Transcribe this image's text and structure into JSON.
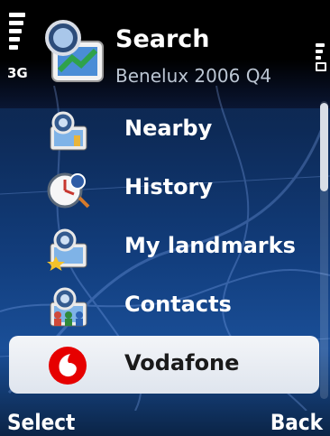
{
  "status": {
    "network": "3G"
  },
  "header": {
    "title": "Search",
    "subtitle": "Benelux 2006 Q4"
  },
  "menu": {
    "items": [
      {
        "label": "Nearby",
        "icon": "map-pin-nearby-icon"
      },
      {
        "label": "History",
        "icon": "history-clock-icon"
      },
      {
        "label": "My landmarks",
        "icon": "landmark-star-icon"
      },
      {
        "label": "Contacts",
        "icon": "contacts-people-icon"
      },
      {
        "label": "Vodafone",
        "icon": "vodafone-logo-icon",
        "selected": true
      }
    ]
  },
  "softkeys": {
    "left": "Select",
    "right": "Back"
  },
  "colors": {
    "background": "#123e7e",
    "selection": "#e6ebf2",
    "text": "#ffffff"
  }
}
